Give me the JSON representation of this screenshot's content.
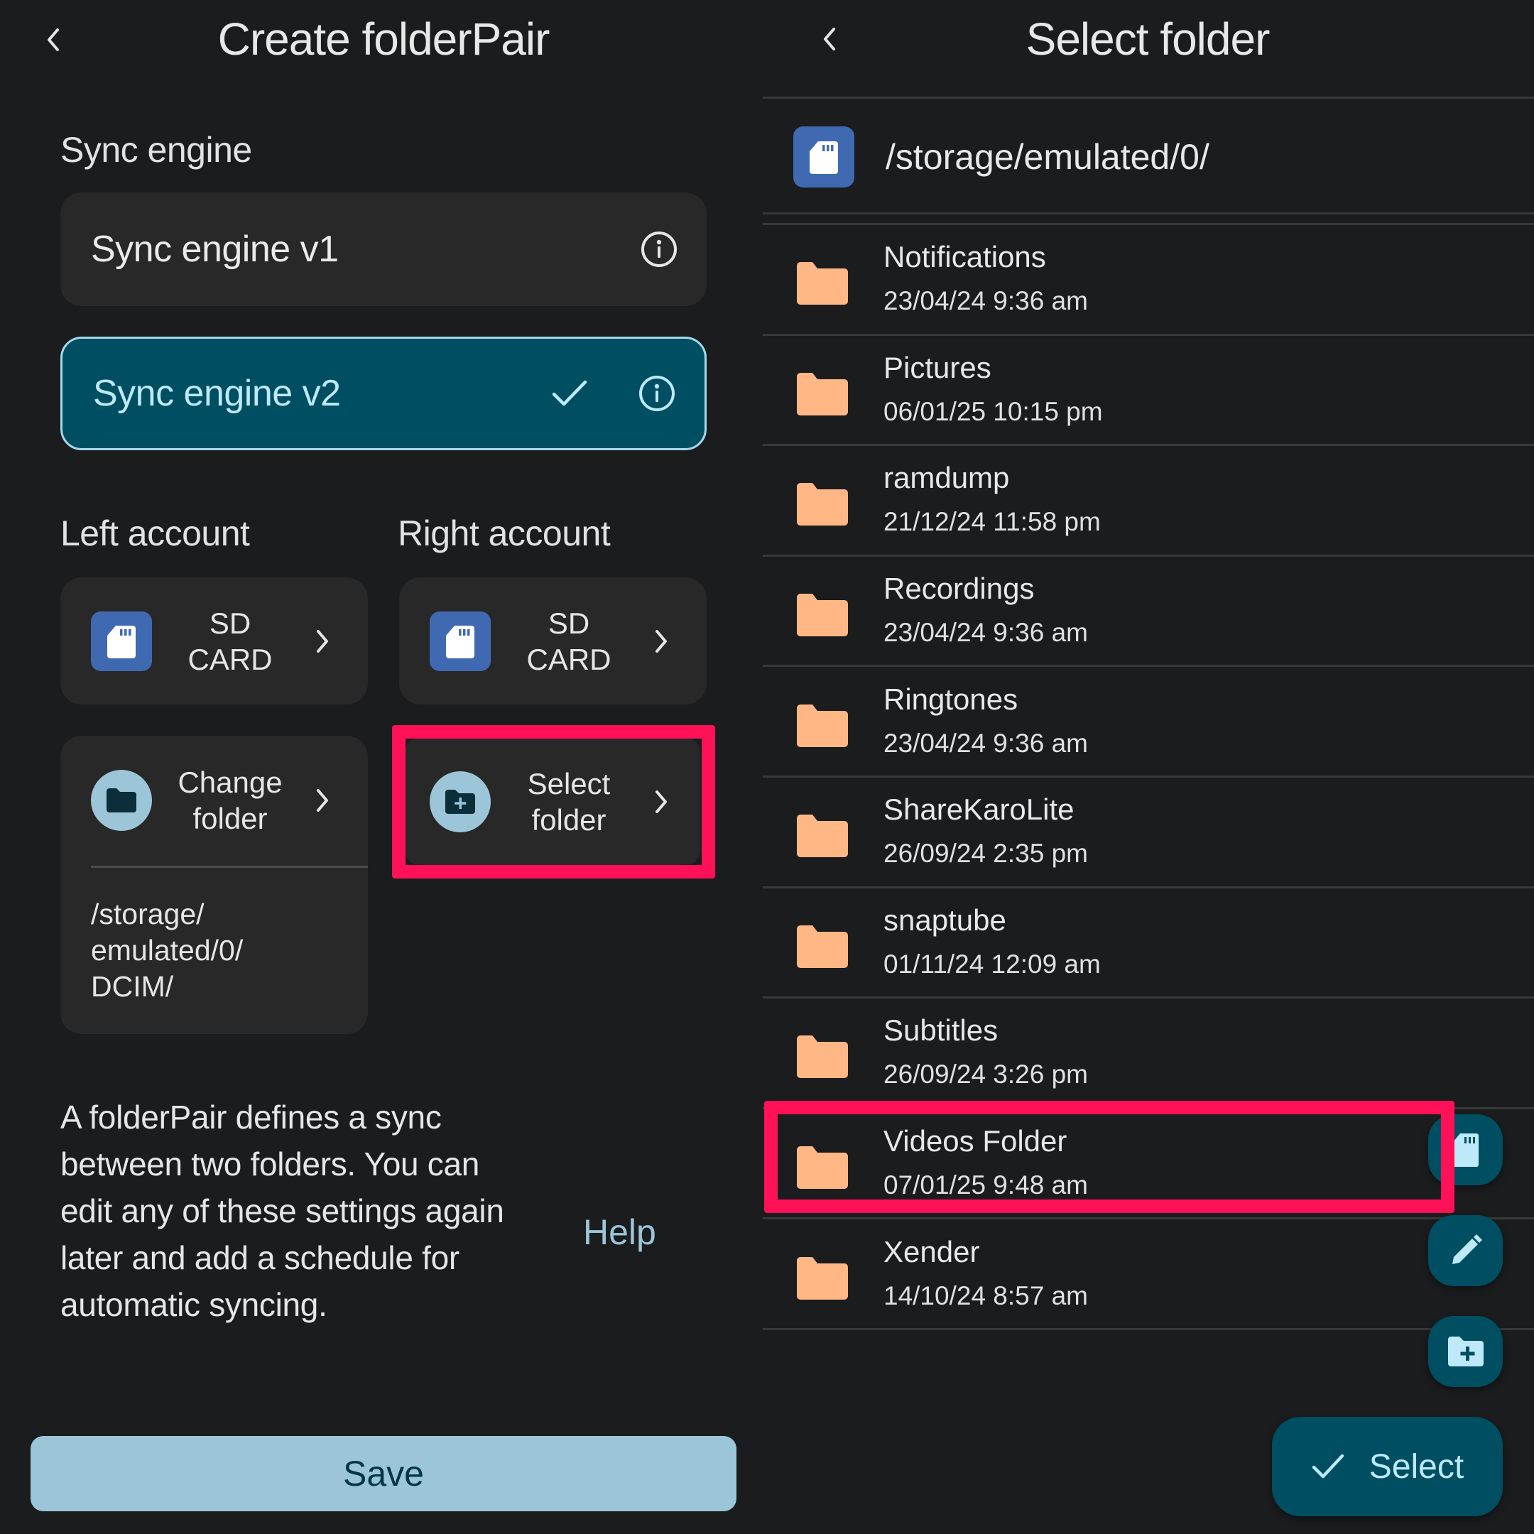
{
  "left_panel": {
    "title": "Create folderPair",
    "sync_engine": {
      "section_label": "Sync engine",
      "options": [
        {
          "label": "Sync engine v1",
          "selected": false,
          "icons": [
            "info-icon"
          ]
        },
        {
          "label": "Sync engine v2",
          "selected": true,
          "icons": [
            "check-icon",
            "info-icon"
          ]
        }
      ]
    },
    "left_account": {
      "label": "Left account",
      "storage_label": "SD CARD",
      "storage_line1": "SD",
      "storage_line2": "CARD",
      "folder_action_line1": "Change",
      "folder_action_line2": "folder",
      "path_line1": "/storage/",
      "path_line2": "emulated/0/",
      "path_line3": "DCIM/"
    },
    "right_account": {
      "label": "Right account",
      "storage_line1": "SD",
      "storage_line2": "CARD",
      "folder_action_line1": "Select",
      "folder_action_line2": "folder",
      "highlighted": true
    },
    "description": "A folderPair defines a sync between two folders. You can edit any of these settings again later and add a schedule for automatic syncing.",
    "help_link": "Help",
    "save_button": "Save"
  },
  "right_panel": {
    "title": "Select folder",
    "current_path": "/storage/emulated/0/",
    "folders": [
      {
        "name": "Notifications",
        "date": "23/04/24 9:36 am"
      },
      {
        "name": "Pictures",
        "date": "06/01/25 10:15 pm"
      },
      {
        "name": "ramdump",
        "date": "21/12/24 11:58 pm"
      },
      {
        "name": "Recordings",
        "date": "23/04/24 9:36 am"
      },
      {
        "name": "Ringtones",
        "date": "23/04/24 9:36 am"
      },
      {
        "name": "ShareKaroLite",
        "date": "26/09/24 2:35 pm"
      },
      {
        "name": "snaptube",
        "date": "01/11/24 12:09 am"
      },
      {
        "name": "Subtitles",
        "date": "26/09/24 3:26 pm"
      },
      {
        "name": "Videos Folder",
        "date": "07/01/25 9:48 am",
        "highlighted": true
      },
      {
        "name": "Xender",
        "date": "14/10/24 8:57 am"
      }
    ],
    "fabs": [
      "sd-card-icon",
      "edit-pencil-icon",
      "create-folder-icon"
    ],
    "select_button": "Select"
  },
  "colors": {
    "background": "#1b1c1e",
    "card": "#282829",
    "selected_card": "#004e62",
    "accent_light": "#9cc5d8",
    "sd_blue": "#3f6ab2",
    "folder_orange": "#ffb785",
    "highlight_red": "#ff1157"
  }
}
